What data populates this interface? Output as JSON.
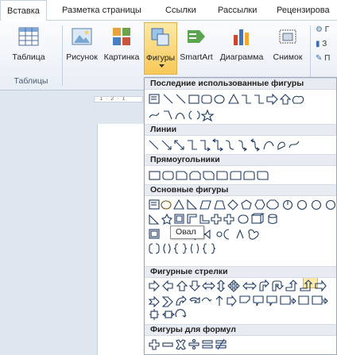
{
  "tabs": [
    {
      "label": "Вставка",
      "active": true
    },
    {
      "label": "Разметка страницы",
      "active": false
    },
    {
      "label": "Ссылки",
      "active": false
    },
    {
      "label": "Рассылки",
      "active": false
    },
    {
      "label": "Рецензирова",
      "active": false
    }
  ],
  "ribbon": {
    "table_label": "Таблица",
    "tables_group": "Таблицы",
    "picture_label": "Рисунок",
    "clipart_label": "Картинка",
    "shapes_label": "Фигуры",
    "smartart_label": "SmartArt",
    "chart_label": "Диаграмма",
    "screenshot_label": "Снимок",
    "side_items": [
      "Г",
      "З",
      "П"
    ]
  },
  "ruler_text": "· 1 · 2 · 1",
  "shapes_menu": {
    "recent": "Последние использованные фигуры",
    "lines": "Линии",
    "rectangles": "Прямоугольники",
    "basic": "Основные фигуры",
    "arrows": "Фигурные стрелки",
    "formulas": "Фигуры для формул"
  },
  "tooltip": "Овал",
  "colors": {
    "accent": "#f7c858",
    "header_bg": "#e8ecf2",
    "shape_stroke": "#1f3b64"
  }
}
